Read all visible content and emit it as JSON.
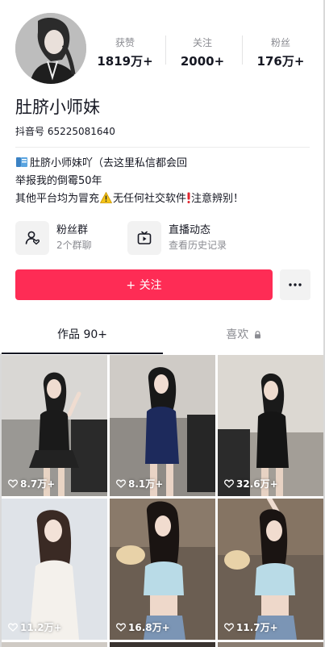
{
  "profile": {
    "name": "肚脐小师妹",
    "uid_label": "抖音号",
    "uid": "65225081640"
  },
  "stats": [
    {
      "label": "获赞",
      "value": "1819万+"
    },
    {
      "label": "关注",
      "value": "2000+"
    },
    {
      "label": "粉丝",
      "value": "176万+"
    }
  ],
  "bio": {
    "line1_text": "肚脐小师妹吖（去这里私信都会回",
    "line2_text": "举报我的倒霉50年",
    "line3_part1": "其他平台均为冒充",
    "line3_part2": "无任何社交软件",
    "line3_part3": "注意辨别！"
  },
  "features": [
    {
      "title": "粉丝群",
      "subtitle": "2个群聊",
      "icon": "fan-group-icon"
    },
    {
      "title": "直播动态",
      "subtitle": "查看历史记录",
      "icon": "live-tv-icon"
    }
  ],
  "actions": {
    "follow_label": "+ 关注",
    "more_icon": "more-dots-icon"
  },
  "tabs": [
    {
      "label": "作品 90+",
      "active": true
    },
    {
      "label": "喜欢",
      "active": false,
      "locked": true
    }
  ],
  "videos": [
    {
      "likes": "8.7万+"
    },
    {
      "likes": "8.1万+"
    },
    {
      "likes": "32.6万+"
    },
    {
      "likes": "11.2万+"
    },
    {
      "likes": "16.8万+"
    },
    {
      "likes": "11.7万+"
    }
  ],
  "colors": {
    "accent": "#fe2c55",
    "text_primary": "#161823",
    "text_secondary": "#8a8b91",
    "chip_bg": "#f2f2f2"
  }
}
